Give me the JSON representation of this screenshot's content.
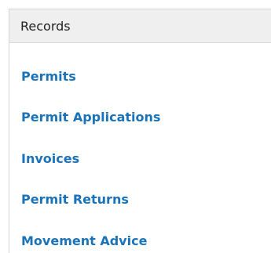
{
  "panel": {
    "title": "Records",
    "accent_color": "#1a73b8",
    "items": [
      {
        "label": "Permits"
      },
      {
        "label": "Permit Applications"
      },
      {
        "label": "Invoices"
      },
      {
        "label": "Permit Returns"
      },
      {
        "label": "Movement Advice"
      }
    ]
  }
}
